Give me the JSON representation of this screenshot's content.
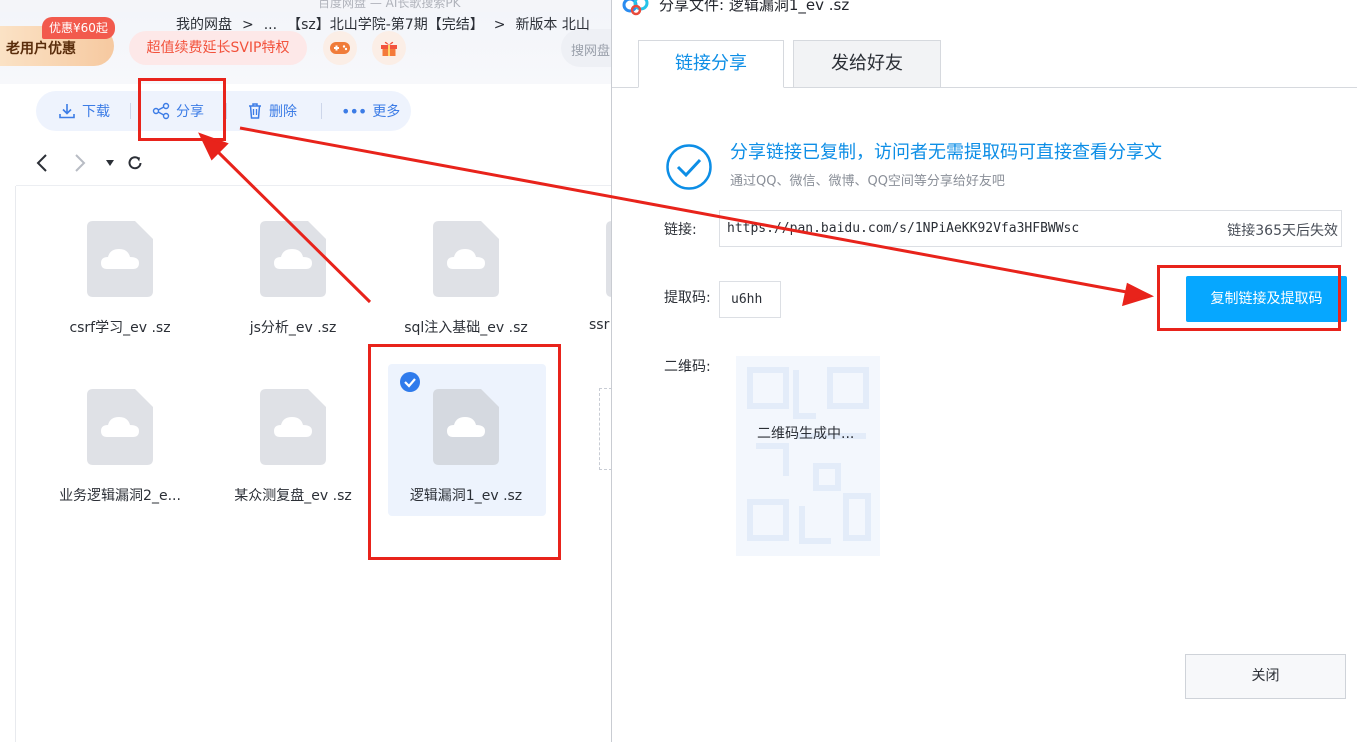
{
  "window_title": "百度网盘 — AI长歌搜索PK",
  "promo": {
    "label": "老用户优惠",
    "badge": "优惠¥60起"
  },
  "vip_pill": "超值续费延长SVIP特权",
  "search": {
    "placeholder": "搜网盘"
  },
  "toolbar": {
    "download": "下载",
    "share": "分享",
    "delete": "删除",
    "more": "更多"
  },
  "breadcrumb": [
    "我的网盘",
    ">",
    "...",
    "【sz】北山学院-第7期【完结】",
    ">",
    "新版本  北山"
  ],
  "files": [
    {
      "name": "csrf学习_ev .sz"
    },
    {
      "name": "js分析_ev .sz"
    },
    {
      "name": "sql注入基础_ev .sz"
    },
    {
      "name": "ssr"
    },
    {
      "name": "业务逻辑漏洞2_e..."
    },
    {
      "name": "某众测复盘_ev .sz"
    },
    {
      "name": "逻辑漏洞1_ev .sz"
    }
  ],
  "dialog": {
    "title": "分享文件: 逻辑漏洞1_ev .sz",
    "tabs": [
      "链接分享",
      "发给好友"
    ],
    "success_title": "分享链接已复制，访问者无需提取码可直接查看分享文",
    "success_sub": "通过QQ、微信、微博、QQ空间等分享给好友吧",
    "link_label": "链接:",
    "link_url": "https://pan.baidu.com/s/1NPiAeKK92Vfa3HFBWWsc",
    "link_expire": "链接365天后失效",
    "code_label": "提取码:",
    "code_value": "u6hh",
    "copy_button": "复制链接及提取码",
    "qr_label": "二维码:",
    "qr_status": "二维码生成中...",
    "close_button": "关闭"
  },
  "colors": {
    "accent": "#06a7ff",
    "annotation": "#e8231b",
    "toolbar_text": "#3c7ce6"
  }
}
